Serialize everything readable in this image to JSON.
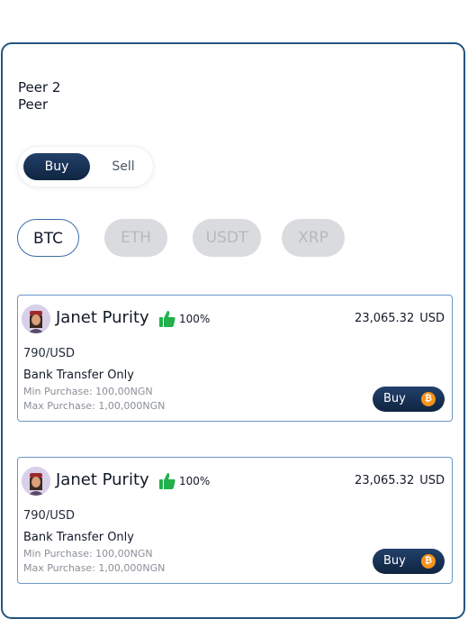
{
  "header": {
    "line1": "Peer 2",
    "line2": "Peer"
  },
  "toggle": {
    "buy": "Buy",
    "sell": "Sell",
    "selected": "Buy"
  },
  "coins": [
    {
      "label": "BTC",
      "active": true
    },
    {
      "label": "ETH",
      "active": false
    },
    {
      "label": "USDT",
      "active": false
    },
    {
      "label": "XRP",
      "active": false
    }
  ],
  "offers": [
    {
      "name": "Janet Purity",
      "rating": "100%",
      "amount": "23,065.32",
      "currency": "USD",
      "rate": "790/USD",
      "method": "Bank Transfer Only",
      "min": "Min Purchase: 100,00NGN",
      "max": "Max Purchase: 1,00,000NGN",
      "button": "Buy",
      "icon": "bitcoin-icon"
    },
    {
      "name": "Janet Purity",
      "rating": "100%",
      "amount": "23,065.32",
      "currency": "USD",
      "rate": "790/USD",
      "method": "Bank Transfer Only",
      "min": "Min Purchase: 100,00NGN",
      "max": "Max Purchase: 1,00,000NGN",
      "button": "Buy",
      "icon": "bitcoin-icon"
    }
  ],
  "colors": {
    "primary": "#1a3253",
    "border": "#23557f",
    "thumb": "#22b14c",
    "bitcoin": "#f7931a"
  }
}
